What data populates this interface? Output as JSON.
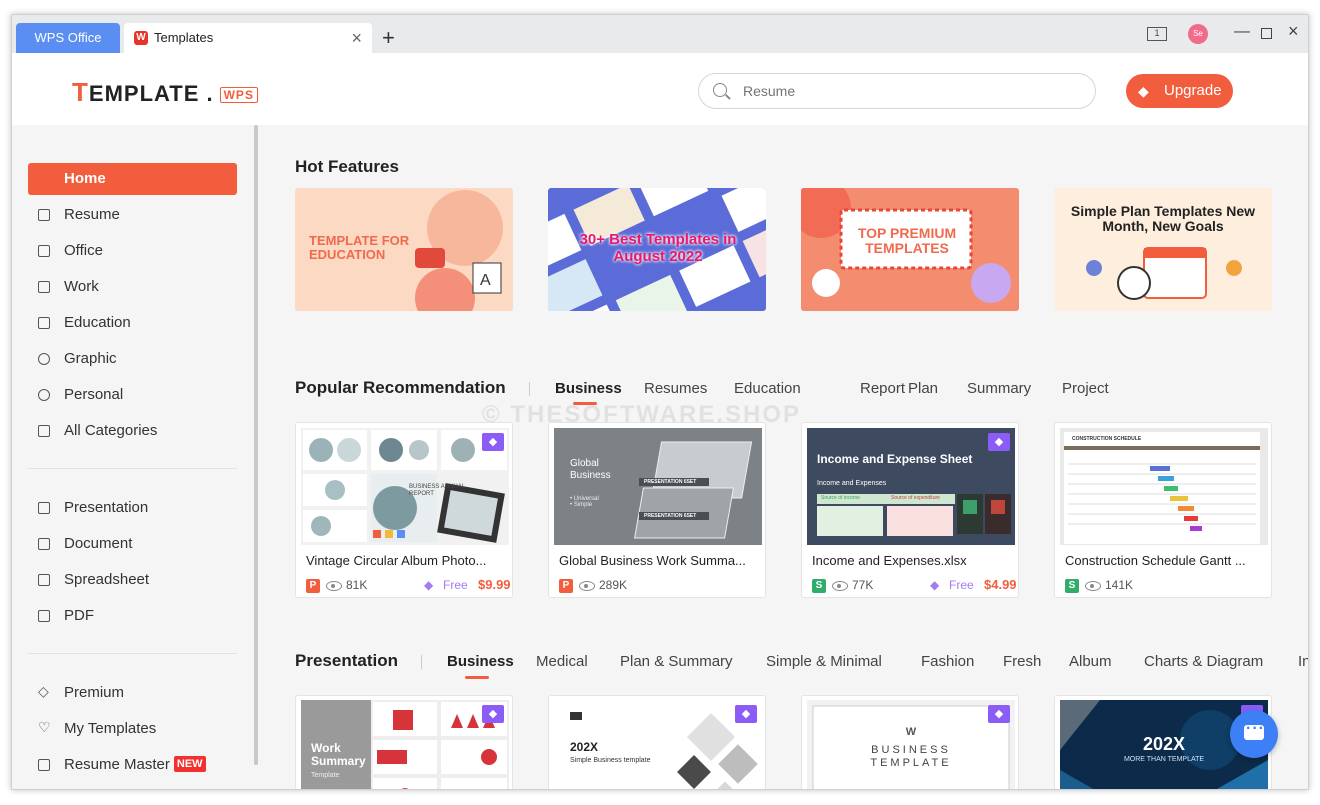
{
  "tabs": {
    "wps_office": "WPS Office",
    "templates": "Templates",
    "templates_logo": "W",
    "close": "×",
    "new_tab": "+"
  },
  "window_controls": {
    "layout": "1",
    "avatar": "Se",
    "minimize": "—",
    "close": "×"
  },
  "header": {
    "logo_first": "T",
    "logo_rest": "EMPLATE .",
    "logo_wps": "WPS",
    "search_placeholder": "Resume",
    "upgrade": "Upgrade"
  },
  "sidebar": {
    "items": [
      {
        "label": "Home",
        "icon": "home-icon"
      },
      {
        "label": "Resume",
        "icon": "resume-icon"
      },
      {
        "label": "Office",
        "icon": "office-icon"
      },
      {
        "label": "Work",
        "icon": "work-icon"
      },
      {
        "label": "Education",
        "icon": "education-icon"
      },
      {
        "label": "Graphic",
        "icon": "graphic-icon"
      },
      {
        "label": "Personal",
        "icon": "personal-icon"
      },
      {
        "label": "All Categories",
        "icon": "grid-icon"
      }
    ],
    "types": [
      {
        "label": "Presentation",
        "icon": "presentation-icon"
      },
      {
        "label": "Document",
        "icon": "document-icon"
      },
      {
        "label": "Spreadsheet",
        "icon": "spreadsheet-icon"
      },
      {
        "label": "PDF",
        "icon": "pdf-icon"
      }
    ],
    "bottom": [
      {
        "label": "Premium",
        "icon": "diamond-icon"
      },
      {
        "label": "My Templates",
        "icon": "heart-icon"
      },
      {
        "label": "Resume Master",
        "icon": "resume-master-icon",
        "badge": "NEW"
      }
    ]
  },
  "hot_features": {
    "title": "Hot Features",
    "banners": [
      {
        "text": "TEMPLATE FOR EDUCATION"
      },
      {
        "text": "30+ Best Templates in August 2022"
      },
      {
        "text": "TOP PREMIUM TEMPLATES"
      },
      {
        "text": "Simple Plan Templates New Month, New Goals"
      }
    ]
  },
  "popular": {
    "title": "Popular Recommendation",
    "tabs": [
      "Business",
      "Resumes",
      "Education",
      "Report",
      "Plan",
      "Summary",
      "Project"
    ],
    "cards": [
      {
        "name": "Vintage Circular Album Photo...",
        "type": "P",
        "views": "81K",
        "free": "Free",
        "price": "$9.99",
        "premium": true
      },
      {
        "name": "Global Business Work Summa...",
        "type": "P",
        "views": "289K",
        "premium": false
      },
      {
        "name": "Income and Expenses.xlsx",
        "type": "S",
        "views": "77K",
        "free": "Free",
        "price": "$4.99",
        "premium": true,
        "thumb_title": "Income and Expense Sheet"
      },
      {
        "name": "Construction Schedule Gantt ...",
        "type": "S",
        "views": "141K",
        "premium": false
      }
    ],
    "card1_thumb": {
      "business": "BUSINESS",
      "annual": "ANNUAL",
      "report": "REPORT"
    },
    "card2_thumb": {
      "title": "Global Business",
      "bullets": "• Universal\n• Simple",
      "tag1": "PRESENTATION 6SET",
      "tag2": "PRESENTATION 6SET"
    },
    "card3_thumb": {
      "sub": "Income and Expenses",
      "col1": "Source of income",
      "col2": "Source of expenditure"
    },
    "card4_thumb": {
      "title": "CONSTRUCTION SCHEDULE"
    }
  },
  "presentation": {
    "title": "Presentation",
    "tabs": [
      "Business",
      "Medical",
      "Plan & Summary",
      "Simple & Minimal",
      "Fashion",
      "Fresh",
      "Album",
      "Charts & Diagram",
      "In"
    ],
    "cards": [
      {
        "thumb_title": "Work Summary",
        "thumb_sub": "Template"
      },
      {
        "thumb_title": "202X",
        "thumb_sub": "Simple Business template"
      },
      {
        "thumb_title": "BUSINESS TEMPLATE",
        "thumb_sub": "W"
      },
      {
        "thumb_title": "202X",
        "thumb_sub": "MORE THAN TEMPLATE"
      }
    ]
  },
  "watermark": "© THESOFTWARE.SHOP",
  "colors": {
    "accent": "#f25d3e",
    "blue": "#5b8ef2",
    "premium": "#8b5cf6"
  }
}
